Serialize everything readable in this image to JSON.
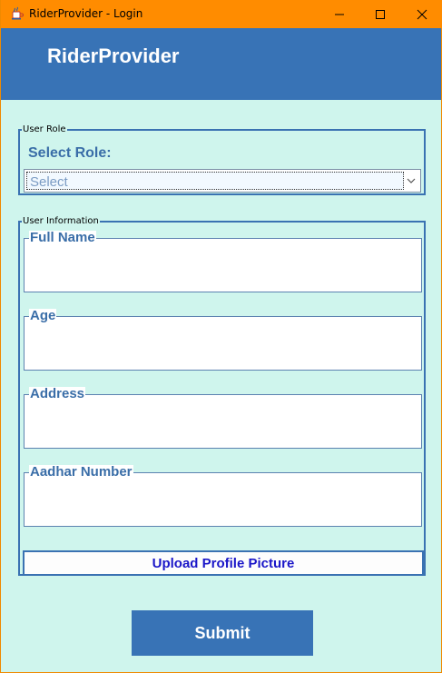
{
  "window": {
    "title": "RiderProvider - Login",
    "icon": "java-coffee-icon",
    "controls": [
      "minimize-icon",
      "maximize-icon",
      "close-icon"
    ]
  },
  "header": {
    "title": "RiderProvider"
  },
  "role_section": {
    "legend": "User Role",
    "label": "Select Role:",
    "select": {
      "value": "Select"
    }
  },
  "info_section": {
    "legend": "User Information",
    "fields": [
      {
        "label": "Full Name",
        "value": ""
      },
      {
        "label": "Age",
        "value": ""
      },
      {
        "label": "Address",
        "value": ""
      },
      {
        "label": "Aadhar Number",
        "value": ""
      }
    ],
    "upload_label": "Upload Profile Picture"
  },
  "submit_label": "Submit",
  "colors": {
    "titlebar": "#ff8c00",
    "header": "#3873b6",
    "background": "#cff5ed",
    "label": "#3a6ea8",
    "upload_text": "#1a16c8"
  }
}
